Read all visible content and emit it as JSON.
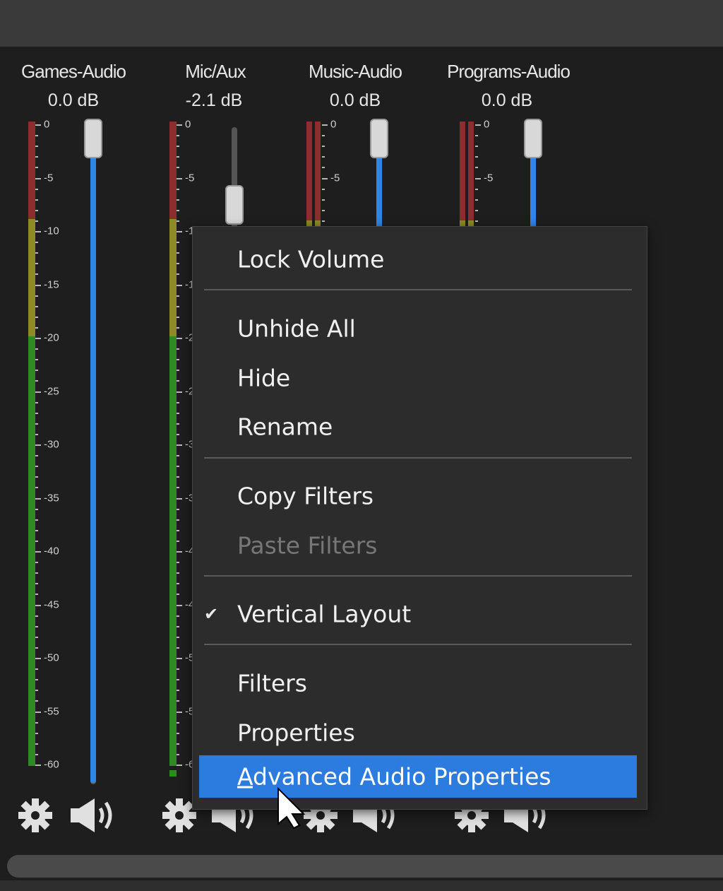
{
  "channels": [
    {
      "name": "Games-Audio",
      "db": "0.0 dB"
    },
    {
      "name": "Mic/Aux",
      "db": "-2.1 dB"
    },
    {
      "name": "Music-Audio",
      "db": "0.0 dB"
    },
    {
      "name": "Programs-Audio",
      "db": "0.0 dB"
    }
  ],
  "scale_labels": [
    "0",
    "-5",
    "-10",
    "-15",
    "-20",
    "-25",
    "-30",
    "-35",
    "-40",
    "-45",
    "-50",
    "-55",
    "-60"
  ],
  "icons": {
    "settings": "gear-icon",
    "mute": "speaker-icon",
    "cursor": "mouse-pointer-icon",
    "check": "checkmark-icon"
  },
  "colors": {
    "accent": "#2b7cde",
    "meter_red": "#8e2d2d",
    "meter_yellow": "#8e8a26",
    "meter_green": "#2e8a22",
    "fader_fill": "#2e86e6"
  },
  "menu": {
    "lock_volume": "Lock Volume",
    "unhide_all": "Unhide All",
    "hide": "Hide",
    "rename": "Rename",
    "copy_filters": "Copy Filters",
    "paste_filters": "Paste Filters",
    "vertical_layout": "Vertical Layout",
    "vertical_layout_check": "✔",
    "filters": "Filters",
    "properties": "Properties",
    "advanced_a": "A",
    "advanced_d": "d",
    "advanced_rest": "vanced Audio Properties"
  }
}
